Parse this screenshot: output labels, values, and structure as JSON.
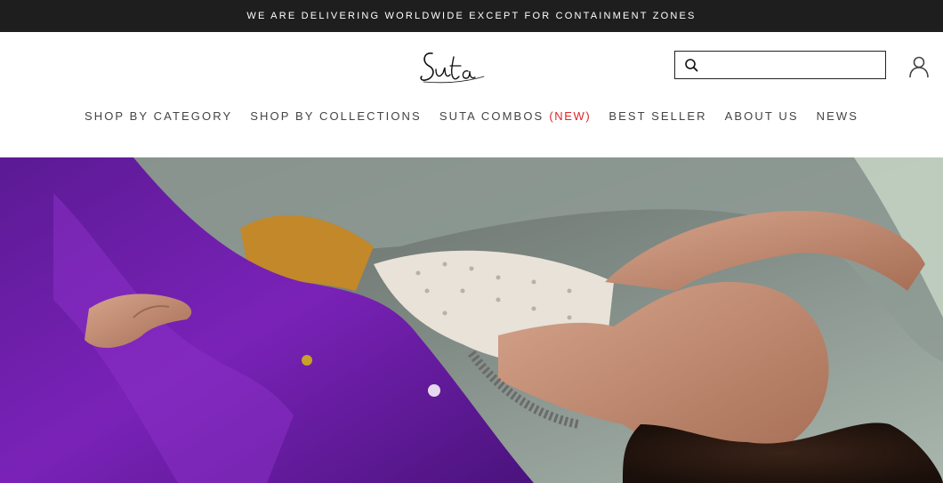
{
  "announcement": {
    "text": "WE ARE DELIVERING WORLDWIDE EXCEPT FOR CONTAINMENT ZONES"
  },
  "header": {
    "logo_text": "Suta",
    "search": {
      "placeholder": "",
      "value": ""
    },
    "icons": {
      "search": "search-icon",
      "account": "user-icon"
    }
  },
  "nav": {
    "items": [
      {
        "label": "SHOP BY CATEGORY"
      },
      {
        "label": "SHOP BY COLLECTIONS"
      },
      {
        "label": "SUTA COMBOS",
        "badge": "(NEW)"
      },
      {
        "label": "BEST SELLER"
      },
      {
        "label": "ABOUT US"
      },
      {
        "label": "NEWS"
      }
    ]
  },
  "colors": {
    "announcement_bg": "#1e1e1e",
    "badge_red": "#e02525",
    "nav_text": "#444444",
    "hero_saree_purple": "#6a1fa3"
  }
}
